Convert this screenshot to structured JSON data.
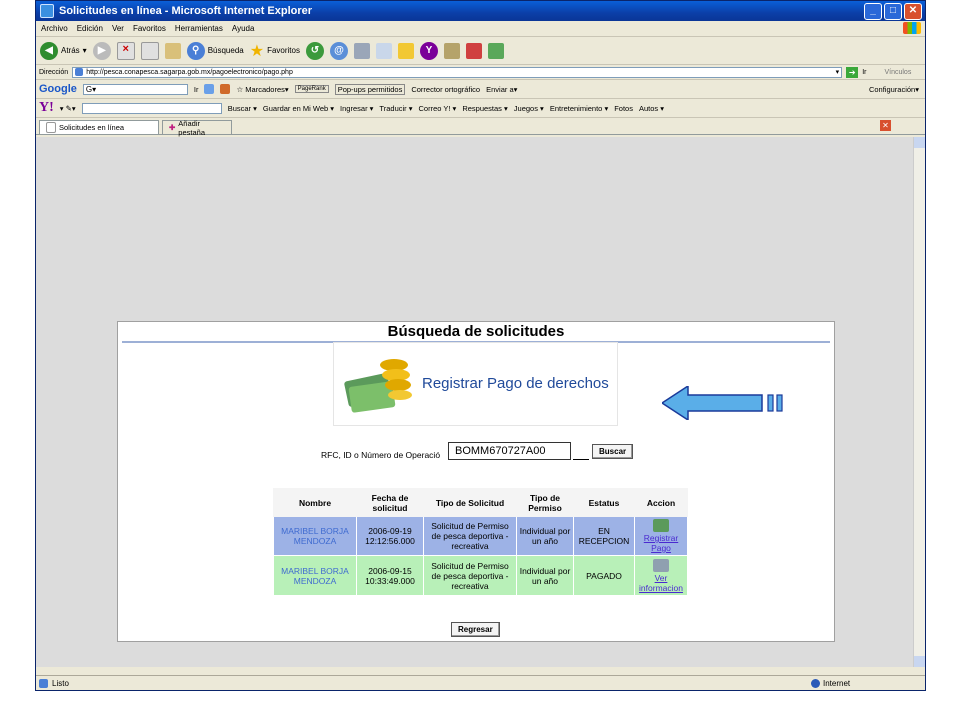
{
  "window": {
    "title": "Solicitudes en línea - Microsoft Internet Explorer"
  },
  "menu": [
    "Archivo",
    "Edición",
    "Ver",
    "Favoritos",
    "Herramientas",
    "Ayuda"
  ],
  "toolbar": {
    "back": "Atrás",
    "search": "Búsqueda",
    "favorites": "Favoritos"
  },
  "address": {
    "label": "Dirección",
    "url": "http://pesca.conapesca.sagarpa.gob.mx/pagoelectronico/pago.php",
    "go": "Ir",
    "links": "Vínculos"
  },
  "google_bar": {
    "logo": "Google",
    "search_label": "G▾",
    "go": "Ir",
    "bookmarks": "Marcadores▾",
    "pagerank": "PageRank",
    "popups": "Pop-ups permitidos",
    "spell": "Corrector ortográfico",
    "send": "Enviar a▾",
    "settings": "Configuración▾"
  },
  "yahoo_bar": {
    "logo": "Y!",
    "items": [
      "Buscar ▾",
      "Guardar en Mi Web ▾",
      "Ingresar ▾",
      "Traducir ▾",
      "Correo Y! ▾",
      "Respuestas ▾",
      "Juegos ▾",
      "Entretenimiento ▾",
      "Fotos",
      "Autos ▾"
    ]
  },
  "tabs": {
    "active": "Solicitudes en línea",
    "add": "Añadir pestaña"
  },
  "status": {
    "text": "Listo",
    "zone": "Internet"
  },
  "page": {
    "title": "Búsqueda de solicitudes",
    "banner": "Registrar Pago de derechos",
    "search_label": "RFC, ID o Número de Operació",
    "search_value": "BOMM670727A00",
    "search_button": "Buscar",
    "back_button": "Regresar"
  },
  "table": {
    "headers": [
      "Nombre",
      "Fecha de solicitud",
      "Tipo de Solicitud",
      "Tipo de Permiso",
      "Estatus",
      "Accion"
    ],
    "rows": [
      {
        "name": "MARIBEL BORJA MENDOZA",
        "date": "2006-09-19 12:12:56.000",
        "type": "Solicitud de Permiso de pesca deportiva - recreativa",
        "permit": "Individual por un año",
        "status": "EN RECEPCION",
        "action": "Registrar Pago"
      },
      {
        "name": "MARIBEL BORJA MENDOZA",
        "date": "2006-09-15 10:33:49.000",
        "type": "Solicitud de Permiso de pesca deportiva - recreativa",
        "permit": "Individual por un año",
        "status": "PAGADO",
        "action": "Ver informacion"
      }
    ]
  },
  "colors": {
    "row_pending": "#9db2e6",
    "row_paid": "#b8f0b8",
    "arrow": "#5aaee8"
  }
}
